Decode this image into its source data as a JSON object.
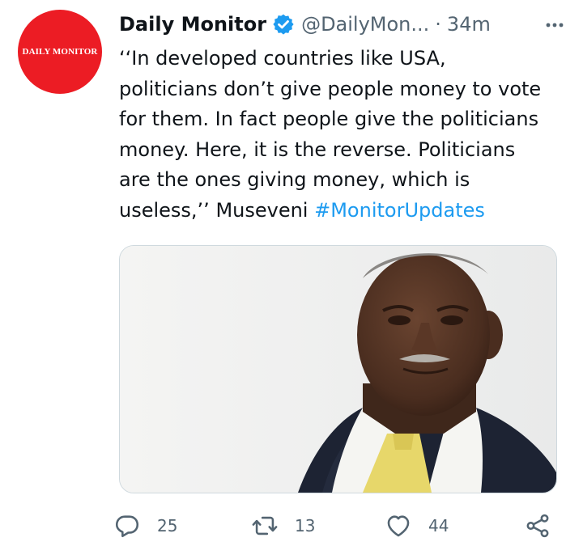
{
  "tweet": {
    "author_name": "Daily Monitor",
    "handle": "@DailyMon...",
    "separator": "·",
    "time": "34m",
    "avatar_text": "DAILY MONITOR",
    "text_lines": [
      "‘‘In developed countries like USA,",
      "politicians don’t give people money to vote",
      "for them. In fact people give the politicians",
      "money. Here, it is the reverse. Politicians",
      "are the ones giving money, which is",
      "useless,’’ Museveni "
    ],
    "hashtag": "#MonitorUpdates",
    "image_icon": "photo-of-museveni"
  },
  "actions": {
    "reply_count": "25",
    "retweet_count": "13",
    "like_count": "44"
  },
  "icons": {
    "verified": "verified-badge-icon",
    "more": "more-options-icon",
    "reply": "reply-icon",
    "retweet": "retweet-icon",
    "like": "heart-icon",
    "share": "share-icon"
  },
  "colors": {
    "avatar_bg": "#ec1c24",
    "verified": "#1d9bf0",
    "hashtag": "#1d9bf0",
    "secondary_text": "#536471"
  }
}
